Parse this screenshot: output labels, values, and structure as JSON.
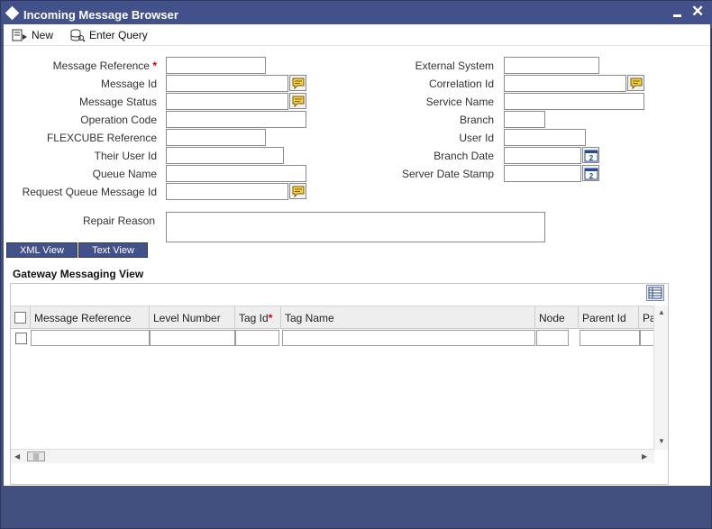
{
  "window": {
    "title": "Incoming Message Browser"
  },
  "toolbar": {
    "new_label": "New",
    "enter_query_label": "Enter Query"
  },
  "form": {
    "left_fields": {
      "message_reference": "Message Reference",
      "message_id": "Message Id",
      "message_status": "Message Status",
      "operation_code": "Operation Code",
      "flexcube_reference": "FLEXCUBE Reference",
      "their_user_id": "Their User Id",
      "queue_name": "Queue Name",
      "request_queue_message_id": "Request Queue Message Id"
    },
    "right_fields": {
      "external_system": "External System",
      "correlation_id": "Correlation Id",
      "service_name": "Service Name",
      "branch": "Branch",
      "user_id": "User Id",
      "branch_date": "Branch Date",
      "server_date_stamp": "Server Date Stamp"
    },
    "repair_reason": "Repair Reason",
    "required_marker": "*"
  },
  "tabs": {
    "xml_view": "XML View",
    "text_view": "Text View"
  },
  "grid": {
    "section_title": "Gateway Messaging View",
    "columns": [
      "Message Reference",
      "Level Number",
      "Tag Id",
      "Tag Name",
      "Node",
      "Parent Id",
      "Pa"
    ],
    "required_column": "Tag Id",
    "rows": 1
  },
  "colors": {
    "title_bar": "#43518a",
    "frame": "#41507e",
    "required": "#cc0000"
  },
  "icons": [
    "new-icon",
    "enter-query-icon",
    "lov-icon",
    "calendar-icon",
    "single-view-icon",
    "close-icon",
    "minimize-icon"
  ]
}
